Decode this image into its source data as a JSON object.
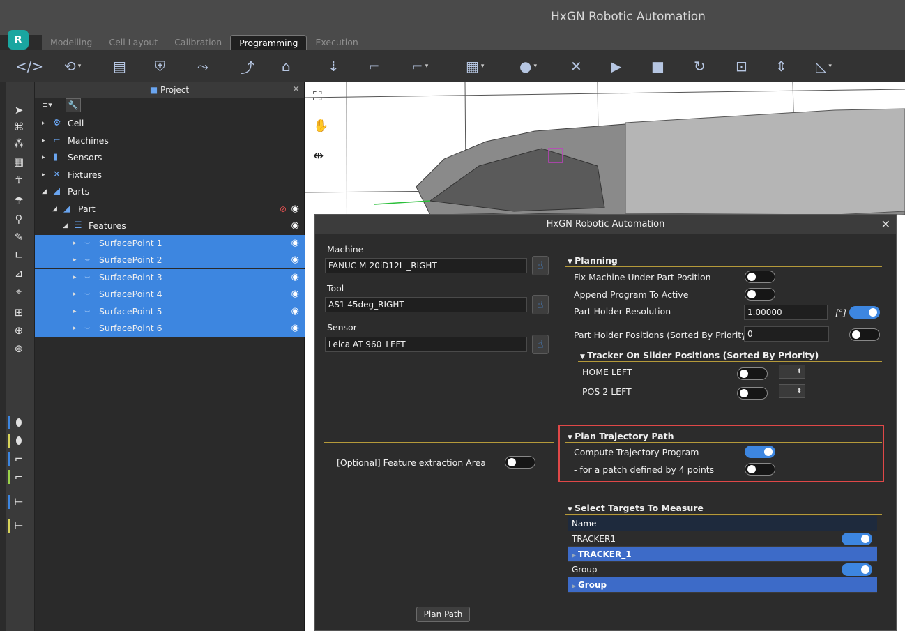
{
  "window": {
    "title": "HxGN Robotic Automation",
    "logo_text": "R"
  },
  "tabs": [
    {
      "label": "Modelling"
    },
    {
      "label": "Cell Layout"
    },
    {
      "label": "Calibration"
    },
    {
      "label": "Programming"
    },
    {
      "label": "Execution"
    }
  ],
  "project_panel": {
    "title": "Project",
    "tree": [
      {
        "label": "Cell",
        "icon": "cell-icon",
        "level": 0,
        "expanded": false,
        "selected": false
      },
      {
        "label": "Machines",
        "icon": "robot-arm-icon",
        "level": 0,
        "expanded": false,
        "selected": false
      },
      {
        "label": "Sensors",
        "icon": "sensor-icon",
        "level": 0,
        "expanded": false,
        "selected": false
      },
      {
        "label": "Fixtures",
        "icon": "fixture-icon",
        "level": 0,
        "expanded": false,
        "selected": false
      },
      {
        "label": "Parts",
        "icon": "part-icon",
        "level": 0,
        "expanded": true,
        "selected": false
      },
      {
        "label": "Part",
        "icon": "part-icon",
        "level": 1,
        "expanded": true,
        "selected": false
      },
      {
        "label": "Features",
        "icon": "list-icon",
        "level": 2,
        "expanded": true,
        "selected": false
      },
      {
        "label": "SurfacePoint 1",
        "icon": "surface-point-icon",
        "level": 3,
        "expanded": false,
        "selected": true
      },
      {
        "label": "SurfacePoint 2",
        "icon": "surface-point-icon",
        "level": 3,
        "expanded": false,
        "selected": true
      },
      {
        "label": "SurfacePoint 3",
        "icon": "surface-point-icon",
        "level": 3,
        "expanded": false,
        "selected": true
      },
      {
        "label": "SurfacePoint 4",
        "icon": "surface-point-icon",
        "level": 3,
        "expanded": false,
        "selected": true
      },
      {
        "label": "SurfacePoint 5",
        "icon": "surface-point-icon",
        "level": 3,
        "expanded": false,
        "selected": true
      },
      {
        "label": "SurfacePoint 6",
        "icon": "surface-point-icon",
        "level": 3,
        "expanded": false,
        "selected": true
      }
    ]
  },
  "dialog": {
    "title": "HxGN Robotic Automation",
    "machine_label": "Machine",
    "machine_value": "FANUC M-20iD12L _RIGHT",
    "tool_label": "Tool",
    "tool_value": "AS1 45deg_RIGHT",
    "sensor_label": "Sensor",
    "sensor_value": "Leica AT 960_LEFT",
    "feature_area_label": "[Optional] Feature extraction Area",
    "feature_area_on": false,
    "planning": {
      "title": "Planning",
      "fix_machine_label": "Fix Machine Under Part Position",
      "fix_machine_on": false,
      "append_program_label": "Append Program To Active",
      "append_program_on": false,
      "resolution_label": "Part Holder Resolution",
      "resolution_value": "1.00000",
      "resolution_unit": "[°]",
      "resolution_toggle_on": true,
      "positions_label": "Part Holder Positions (Sorted By Priority)",
      "positions_value": "0",
      "positions_toggle_on": false,
      "slider_title": "Tracker On Slider Positions (Sorted By Priority)",
      "slider_positions": [
        {
          "label": "HOME LEFT",
          "on": false
        },
        {
          "label": "POS 2 LEFT",
          "on": false
        }
      ]
    },
    "trajectory": {
      "title": "Plan Trajectory Path",
      "compute_label": "Compute Trajectory Program",
      "compute_on": true,
      "patch_label": "- for a patch defined by 4 points",
      "patch_on": false
    },
    "targets": {
      "title": "Select Targets To Measure",
      "header": "Name",
      "rows": [
        {
          "label": "TRACKER1",
          "kind": "plain",
          "on": true
        },
        {
          "label": "TRACKER_1",
          "kind": "group"
        },
        {
          "label": "Group",
          "kind": "plain",
          "on": true
        },
        {
          "label": "Group",
          "kind": "group"
        }
      ]
    },
    "plan_button": "Plan Path"
  },
  "colors": {
    "accent": "#3d86e0",
    "section_line": "#b59a3a",
    "highlight_box": "#e04848",
    "logo": "#1aa6a0"
  }
}
